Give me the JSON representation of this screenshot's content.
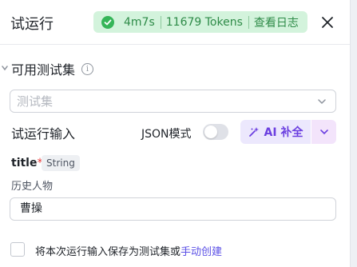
{
  "header": {
    "title": "试运行",
    "status": {
      "duration": "4m7s",
      "tokens": "11679 Tokens",
      "view_log": "查看日志"
    }
  },
  "test_set": {
    "title": "可用测试集",
    "placeholder": "测试集"
  },
  "run_input": {
    "label": "试运行输入",
    "json_mode_label": "JSON模式",
    "json_mode_on": false,
    "ai_button_label": "AI 补全"
  },
  "field": {
    "name": "title",
    "required_mark": "*",
    "type": "String",
    "description": "历史人物",
    "value": "曹操"
  },
  "footer": {
    "save_text": "将本次运行输入保存为测试集或",
    "save_link": "手动创建",
    "checked": false
  },
  "colors": {
    "success": "#35b558",
    "accent": "#6b3fe0",
    "link": "#5b50e6"
  }
}
